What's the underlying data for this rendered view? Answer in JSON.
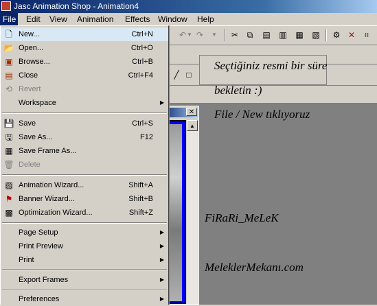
{
  "window": {
    "title": "Jasc Animation Shop - Animation4"
  },
  "menubar": {
    "items": [
      "File",
      "Edit",
      "View",
      "Animation",
      "Effects",
      "Window",
      "Help"
    ]
  },
  "file_menu": {
    "items": [
      {
        "label": "New...",
        "shortcut": "Ctrl+N",
        "icon": "new-file-icon"
      },
      {
        "label": "Open...",
        "shortcut": "Ctrl+O",
        "icon": "open-folder-icon"
      },
      {
        "label": "Browse...",
        "shortcut": "Ctrl+B",
        "icon": "browse-icon"
      },
      {
        "label": "Close",
        "shortcut": "Ctrl+F4",
        "icon": "close-doc-icon"
      },
      {
        "label": "Revert",
        "shortcut": "",
        "icon": "revert-icon"
      },
      {
        "label": "Workspace",
        "shortcut": "",
        "icon": ""
      },
      {
        "label": "Save",
        "shortcut": "Ctrl+S",
        "icon": "save-icon"
      },
      {
        "label": "Save As...",
        "shortcut": "F12",
        "icon": "save-as-icon"
      },
      {
        "label": "Save Frame As...",
        "shortcut": "",
        "icon": "save-frame-icon"
      },
      {
        "label": "Delete",
        "shortcut": "",
        "icon": "delete-icon"
      },
      {
        "label": "Animation Wizard...",
        "shortcut": "Shift+A",
        "icon": "animation-wizard-icon"
      },
      {
        "label": "Banner Wizard...",
        "shortcut": "Shift+B",
        "icon": "banner-wizard-icon"
      },
      {
        "label": "Optimization Wizard...",
        "shortcut": "Shift+Z",
        "icon": "optimization-wizard-icon"
      },
      {
        "label": "Page Setup",
        "shortcut": "",
        "icon": ""
      },
      {
        "label": "Print Preview",
        "shortcut": "",
        "icon": ""
      },
      {
        "label": "Print",
        "shortcut": "",
        "icon": ""
      },
      {
        "label": "Export Frames",
        "shortcut": "",
        "icon": ""
      },
      {
        "label": "Preferences",
        "shortcut": "",
        "icon": ""
      }
    ]
  },
  "overlay_text": {
    "line1": "Seçtiğiniz resmi bir süre",
    "line2": "bekletin :)",
    "line3": "File / New tıklıyoruz",
    "signature": "FiRaRi_MeLeK",
    "site": "MeleklerMekanı.com"
  },
  "toolbar": {
    "icons": [
      "undo-icon",
      "redo-icon",
      "cut-icon",
      "copy-icon",
      "paste-icon",
      "paste-new-icon",
      "paste-frame-icon",
      "paste-after-icon",
      "properties-icon",
      "delete-frame-icon",
      "crop-icon"
    ]
  },
  "colors": {
    "title_bar": "#0a246a",
    "menu_highlight": "#d8e8f4",
    "canvas_border": "#0000ff",
    "workspace": "#808080"
  }
}
